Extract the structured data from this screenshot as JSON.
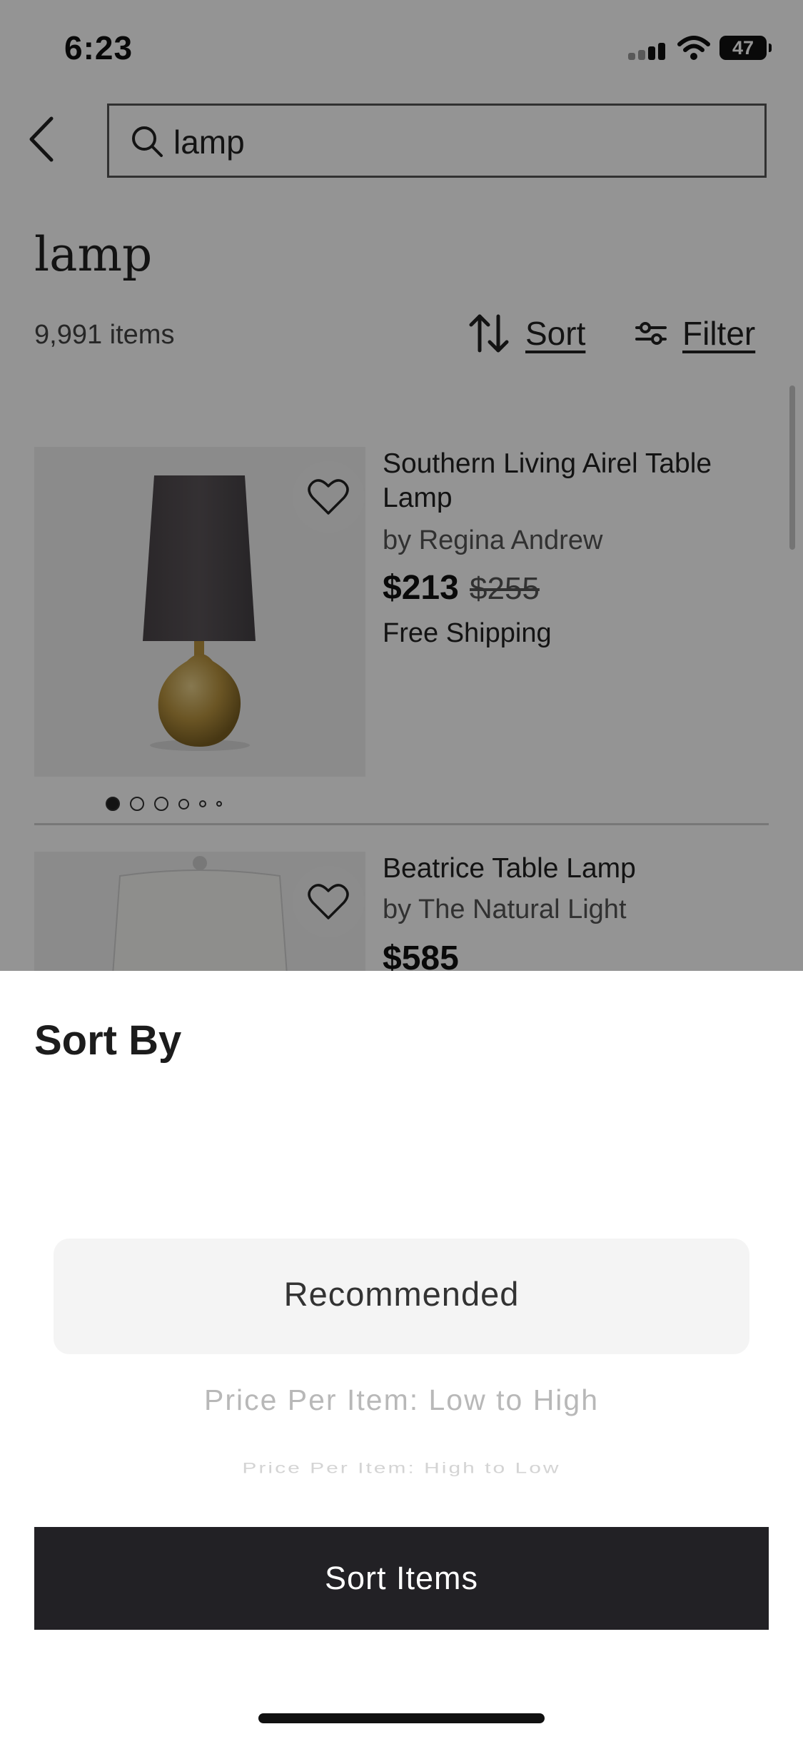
{
  "status_bar": {
    "time": "6:23",
    "battery": "47"
  },
  "search": {
    "query": "lamp"
  },
  "results": {
    "title": "lamp",
    "count": "9,991 items",
    "sort_label": "Sort",
    "filter_label": "Filter"
  },
  "products": [
    {
      "title": "Southern Living Airel Table Lamp",
      "brand": "by Regina Andrew",
      "price": "$213",
      "old_price": "$255",
      "shipping": "Free Shipping",
      "image_index": "1 of 6"
    },
    {
      "title": "Beatrice Table Lamp",
      "brand": "by The Natural Light",
      "price": "$585"
    }
  ],
  "sort_sheet": {
    "title": "Sort By",
    "options": [
      "Recommended",
      "Price Per Item: Low to High",
      "Price Per Item: High to Low"
    ],
    "selected": "Recommended",
    "button_label": "Sort Items"
  }
}
